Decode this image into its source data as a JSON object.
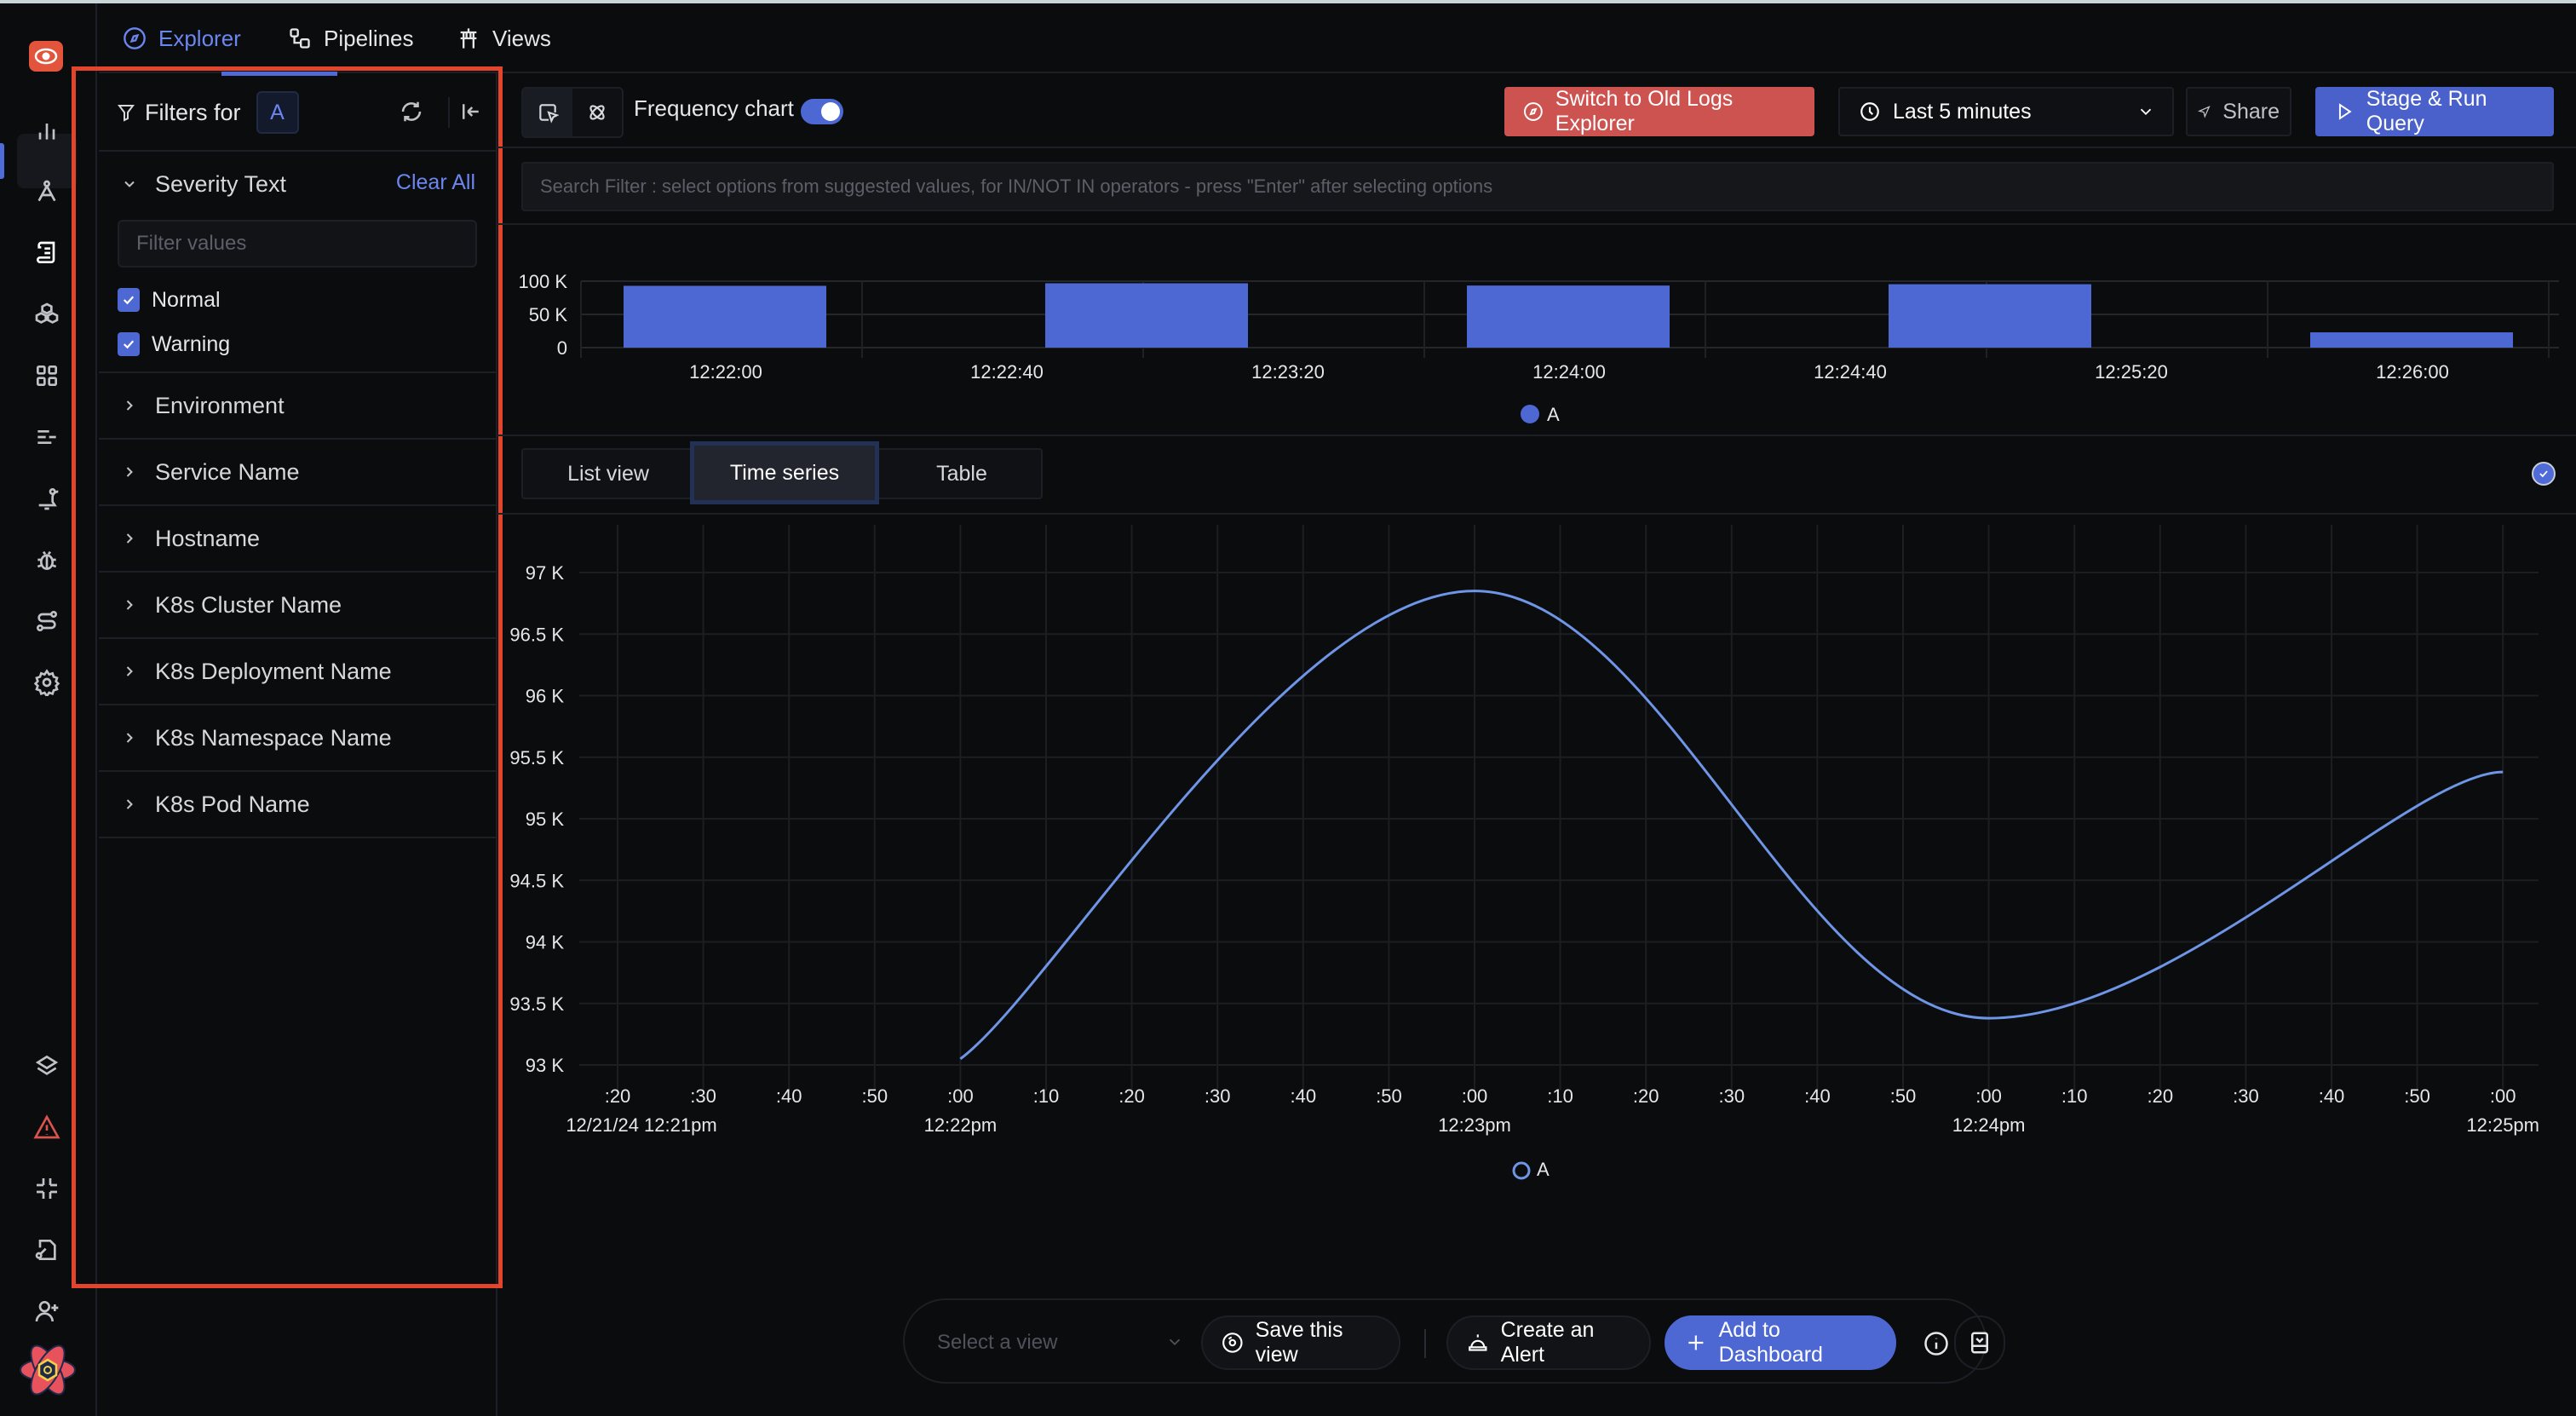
{
  "nav": {
    "tabs": [
      {
        "label": "Explorer",
        "icon": "compass-icon",
        "active": true
      },
      {
        "label": "Pipelines",
        "icon": "pipeline-icon",
        "active": false
      },
      {
        "label": "Views",
        "icon": "views-icon",
        "active": false
      }
    ]
  },
  "rail": {
    "top_icons": [
      "bar-chart-icon",
      "compass-tool-icon",
      "logs-scroll-icon",
      "cubes-icon",
      "dashboard-grid-icon",
      "list-lines-icon",
      "bell-alert-icon",
      "bug-icon",
      "route-icon",
      "settings-gear-icon"
    ],
    "active": "logs-scroll-icon",
    "bottom_icons": [
      "layers-icon",
      "warning-triangle-icon",
      "slack-icon",
      "license-key-icon",
      "invite-user-icon",
      "user-avatar-icon"
    ]
  },
  "filters": {
    "title": "Filters for",
    "query_badge": "A",
    "sections": [
      {
        "label": "Severity Text",
        "expanded": true,
        "clear_label": "Clear All",
        "search_placeholder": "Filter values",
        "options": [
          {
            "label": "Normal",
            "checked": true
          },
          {
            "label": "Warning",
            "checked": true
          }
        ]
      },
      {
        "label": "Environment",
        "expanded": false
      },
      {
        "label": "Service Name",
        "expanded": false
      },
      {
        "label": "Hostname",
        "expanded": false
      },
      {
        "label": "K8s Cluster Name",
        "expanded": false
      },
      {
        "label": "K8s Deployment Name",
        "expanded": false
      },
      {
        "label": "K8s Namespace Name",
        "expanded": false
      },
      {
        "label": "K8s Pod Name",
        "expanded": false
      }
    ]
  },
  "toolbar": {
    "frequency_label": "Frequency chart",
    "frequency_enabled": true,
    "switch_old": "Switch to Old Logs Explorer",
    "time_range": "Last 5 minutes",
    "share": "Share",
    "run": "Stage & Run Query"
  },
  "search": {
    "placeholder": "Search Filter : select options from suggested values, for IN/NOT IN operators - press \"Enter\" after selecting options"
  },
  "view_tabs": [
    {
      "label": "List view",
      "active": false
    },
    {
      "label": "Time series",
      "active": true
    },
    {
      "label": "Table",
      "active": false
    }
  ],
  "action_bar": {
    "select_view_placeholder": "Select a view",
    "save_view": "Save this view",
    "create_alert": "Create an Alert",
    "add_dashboard": "Add to Dashboard"
  },
  "colors": {
    "accent": "#4e68d3",
    "line": "#6f95e6",
    "danger": "#cd5350",
    "highlight_outline": "#e3452c"
  },
  "chart_data": [
    {
      "type": "bar",
      "title": "Frequency chart",
      "categories": [
        "12:22:00",
        "12:23:00",
        "12:24:00",
        "12:25:00",
        "12:26:00"
      ],
      "values": [
        93000,
        96800,
        93400,
        95400,
        23000
      ],
      "x_tick_labels": [
        "12:22:00",
        "12:22:40",
        "12:23:20",
        "12:24:00",
        "12:24:40",
        "12:25:20",
        "12:26:00"
      ],
      "y_tick_labels": [
        "0",
        "50 K",
        "100 K"
      ],
      "ylim": [
        0,
        100000
      ],
      "legend": [
        "A"
      ],
      "legend_position": "bottom-center",
      "grid": true
    },
    {
      "type": "line",
      "title": "",
      "series": [
        {
          "name": "A",
          "x": [
            "12:22:00",
            "12:23:00",
            "12:24:00",
            "12:25:00"
          ],
          "values": [
            93050,
            96850,
            93380,
            95380
          ]
        }
      ],
      "x_tick_labels": [
        ":20",
        ":30",
        ":40",
        ":50",
        ":00",
        ":10",
        ":20",
        ":30",
        ":40",
        ":50",
        ":00",
        ":10",
        ":20",
        ":30",
        ":40",
        ":50",
        ":00",
        ":10",
        ":20",
        ":30",
        ":40",
        ":50",
        ":00"
      ],
      "x_major_labels": [
        {
          "at": ":20",
          "label": "12/21/24 12:21pm"
        },
        {
          "at": ":00",
          "label": "12:22pm"
        },
        {
          "at": ":00",
          "label": "12:23pm"
        },
        {
          "at": ":00",
          "label": "12:24pm"
        },
        {
          "at": ":00",
          "label": "12:25pm"
        }
      ],
      "y_tick_labels": [
        "93 K",
        "93.5 K",
        "94 K",
        "94.5 K",
        "95 K",
        "95.5 K",
        "96 K",
        "96.5 K",
        "97 K"
      ],
      "ylim": [
        93000,
        97000
      ],
      "xlabel": "",
      "ylabel": "",
      "legend": [
        "A"
      ],
      "legend_position": "bottom-center",
      "grid": true
    }
  ]
}
